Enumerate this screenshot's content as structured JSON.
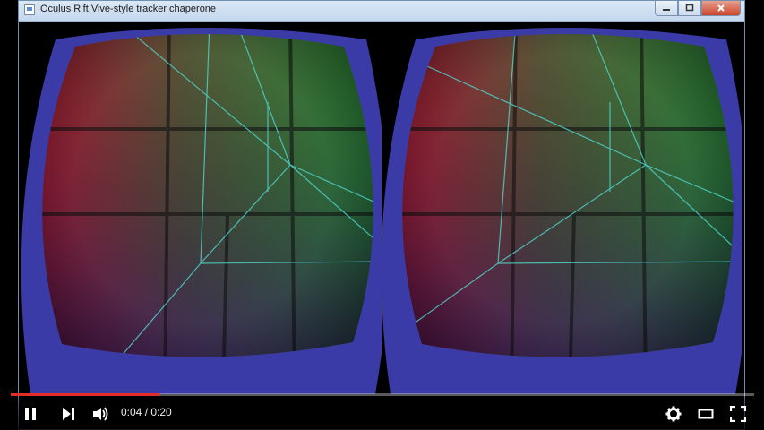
{
  "window": {
    "title": "Oculus Rift Vive-style tracker chaperone",
    "buttons": {
      "minimize": "minimize",
      "maximize": "maximize",
      "close": "close"
    }
  },
  "player": {
    "current_time": "0:04",
    "duration": "0:20",
    "time_display": "0:04 / 0:20",
    "progress": 0.2,
    "accent": "#e52d27",
    "controls": [
      "pause-icon",
      "next-icon",
      "volume-icon",
      "gear-icon",
      "theater-icon",
      "fullscreen-icon"
    ]
  },
  "scene": {
    "left_wall": "#c81a3a",
    "right_wall": "#3aa04a",
    "floor": "#2a2a8a",
    "grid_line": "#4fd0c8",
    "bezel": "#3b3ba8"
  }
}
